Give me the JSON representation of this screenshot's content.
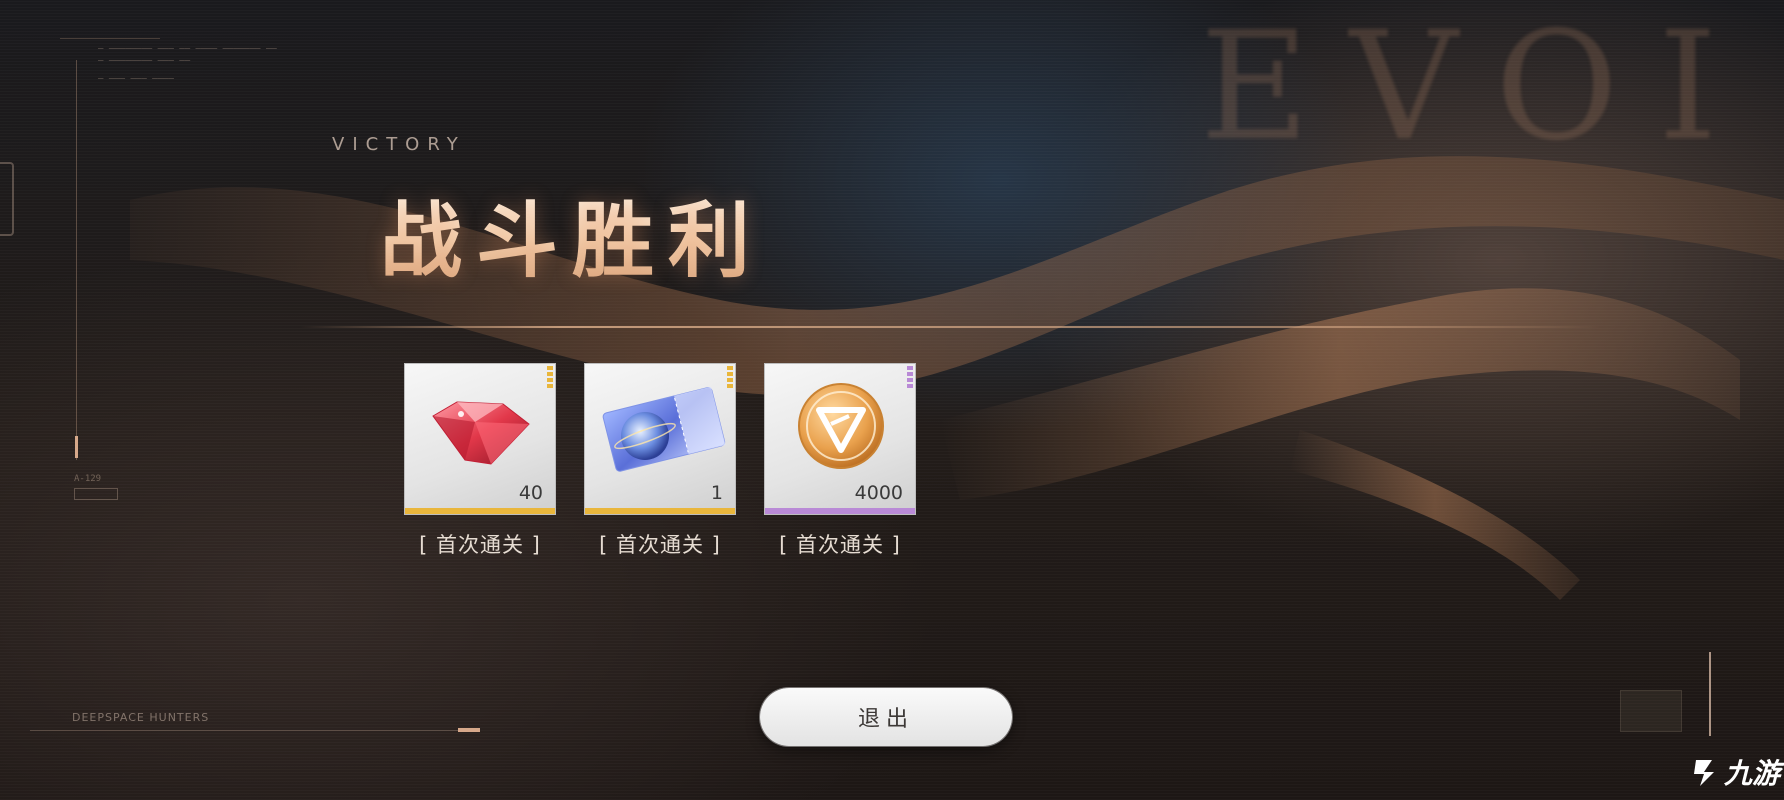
{
  "background": {
    "watermark_word": "EVOI",
    "hud_lines": [
      "— ———————— ——— —— ———— ——————— ——",
      "— ———————— ——— ——",
      "— ——— ——— ————"
    ],
    "hud_code": "A-129",
    "corner_label": "DEEPSPACE HUNTERS"
  },
  "header": {
    "subtitle": "VICTORY",
    "title": "战斗胜利"
  },
  "rewards": [
    {
      "icon": "red-gem-icon",
      "count": "40",
      "tag": "[ 首次通关 ]",
      "rarity_color": "#e9b63c"
    },
    {
      "icon": "ticket-card-icon",
      "count": "1",
      "tag": "[ 首次通关 ]",
      "rarity_color": "#e9b63c"
    },
    {
      "icon": "gold-coin-icon",
      "count": "4000",
      "tag": "[ 首次通关 ]",
      "rarity_color": "#b98ad6"
    }
  ],
  "actions": {
    "exit_label": "退出"
  },
  "watermark": {
    "text": "九游",
    "logo": "jiuyou-logo-icon"
  }
}
